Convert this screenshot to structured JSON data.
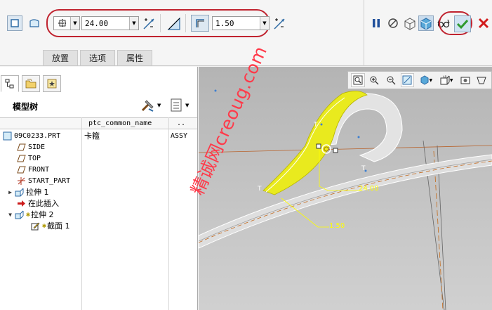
{
  "dashboard": {
    "dim1_value": "24.00",
    "dim2_value": "1.50",
    "tabs": [
      "放置",
      "选项",
      "属性"
    ]
  },
  "model_tree": {
    "title": "模型树",
    "columns": [
      "ptc_common_name",
      ".."
    ],
    "rows": [
      {
        "label": "09C0233.PRT",
        "common_name": "卡箍",
        "extra": "ASSY"
      },
      {
        "label": "SIDE"
      },
      {
        "label": "TOP"
      },
      {
        "label": "FRONT"
      },
      {
        "label": "START_PART"
      },
      {
        "label": "拉伸 1"
      },
      {
        "label": "在此插入"
      },
      {
        "label": "拉伸 2"
      },
      {
        "label": "截面 1"
      }
    ]
  },
  "viewport": {
    "dim_24": "24.00",
    "dim_15": "1.50"
  },
  "watermark": "精诚网creoug.com",
  "colors": {
    "highlight_oval": "#c0232f",
    "geometry_yellow": "#e9ea1e",
    "dimension_text": "#ffff00",
    "ok_green": "#2e9a2e",
    "cancel_red": "#d21d1d"
  }
}
